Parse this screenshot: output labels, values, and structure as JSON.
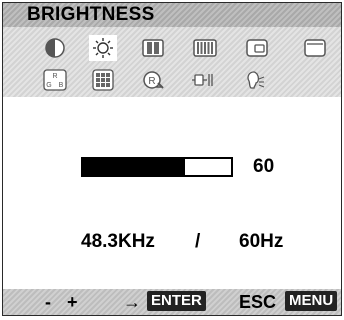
{
  "title": "BRIGHTNESS",
  "icons": [
    {
      "name": "contrast-icon"
    },
    {
      "name": "brightness-icon",
      "selected": true
    },
    {
      "name": "h-position-icon"
    },
    {
      "name": "h-size-icon"
    },
    {
      "name": "v-position-icon"
    },
    {
      "name": "v-size-icon"
    },
    {
      "name": "color-rgb-icon"
    },
    {
      "name": "geometry-grid-icon"
    },
    {
      "name": "recall-icon"
    },
    {
      "name": "degauss-icon"
    },
    {
      "name": "language-icon"
    }
  ],
  "brightness": {
    "value": "60",
    "level": 0.69
  },
  "frequency": {
    "horizontal": "48.3KHz",
    "separator": "/",
    "vertical": "60Hz"
  },
  "footer": {
    "minus": "-",
    "plus": "+",
    "arrow": "→",
    "enter": "ENTER",
    "esc": "ESC",
    "menu": "MENU"
  }
}
